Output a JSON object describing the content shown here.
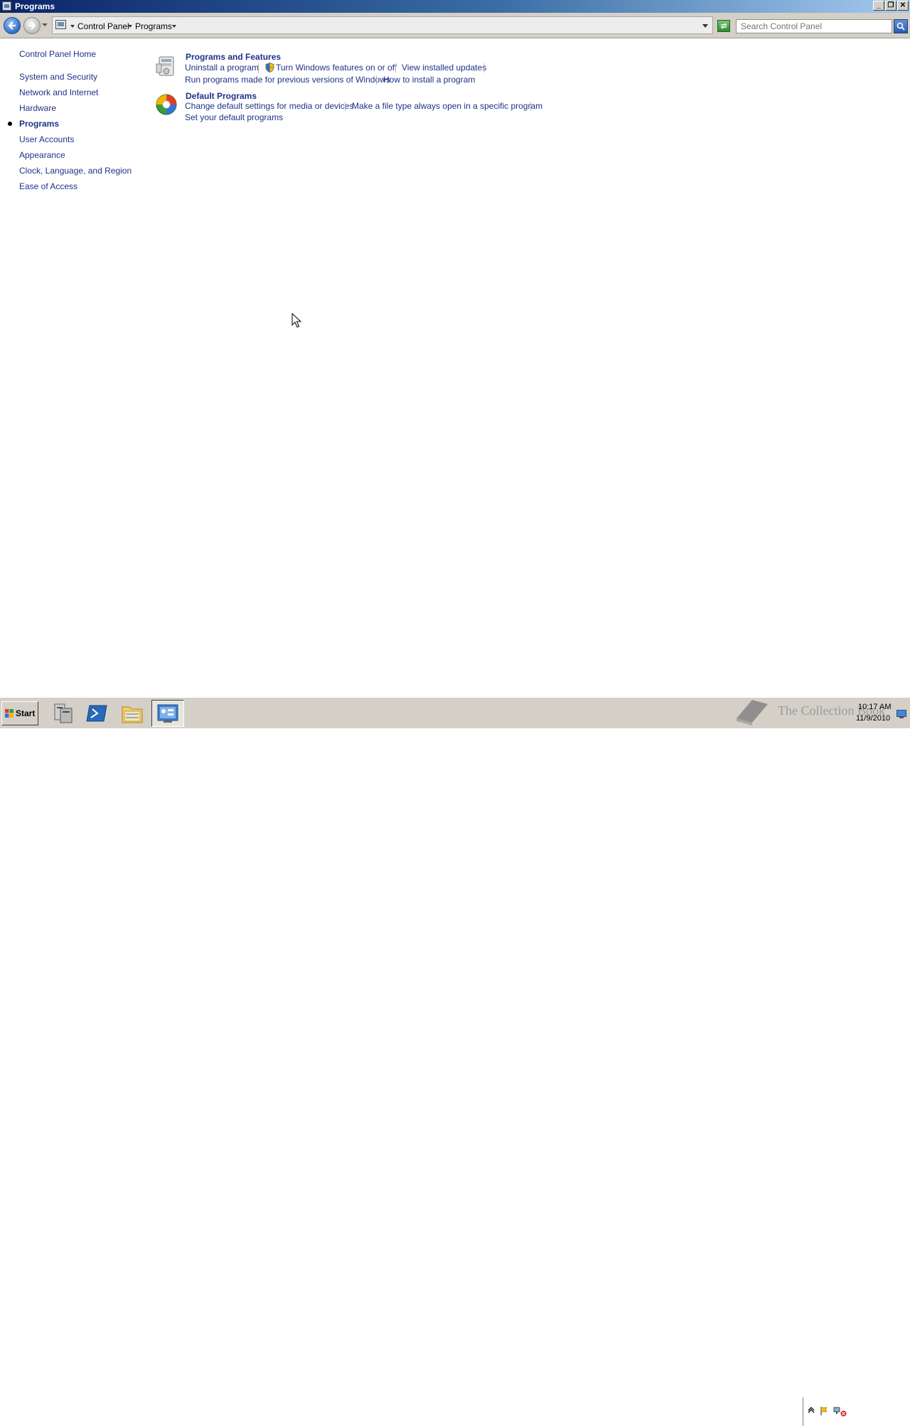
{
  "window": {
    "title": "Programs",
    "buttons": {
      "minimize": "_",
      "restore": "❐",
      "close": "✕"
    }
  },
  "address_bar": {
    "breadcrumbs": [
      "Control Panel",
      "Programs"
    ],
    "search_placeholder": "Search Control Panel"
  },
  "left_nav": {
    "items": [
      {
        "label": "Control Panel Home",
        "current": false
      },
      {
        "label": "System and Security",
        "current": false
      },
      {
        "label": "Network and Internet",
        "current": false
      },
      {
        "label": "Hardware",
        "current": false
      },
      {
        "label": "Programs",
        "current": true
      },
      {
        "label": "User Accounts",
        "current": false
      },
      {
        "label": "Appearance",
        "current": false
      },
      {
        "label": "Clock, Language, and Region",
        "current": false
      },
      {
        "label": "Ease of Access",
        "current": false
      }
    ]
  },
  "categories": [
    {
      "title": "Programs and Features",
      "icon": "programs-features-icon",
      "links": [
        "Uninstall a program",
        "Turn Windows features on or off",
        "View installed updates",
        "Run programs made for previous versions of Windows",
        "How to install a program"
      ]
    },
    {
      "title": "Default Programs",
      "icon": "default-programs-icon",
      "links": [
        "Change default settings for media or devices",
        "Make a file type always open in a specific program",
        "Set your default programs"
      ]
    }
  ],
  "taskbar": {
    "start_label": "Start",
    "pinned": [
      "server-manager-icon",
      "powershell-icon",
      "explorer-icon",
      "control-panel-icon"
    ],
    "watermark": "The Collection Book",
    "clock_time": "10:17 AM",
    "clock_date": "11/9/2010"
  },
  "colors": {
    "link": "#1e3287",
    "title_bar_start": "#0a246a",
    "title_bar_end": "#a6caf0",
    "chrome": "#d4d0c8"
  }
}
